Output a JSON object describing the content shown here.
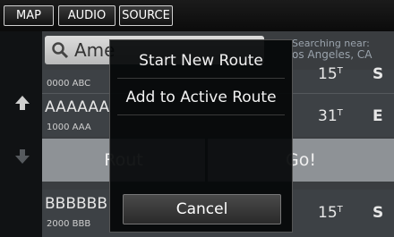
{
  "tabs": {
    "map": "MAP",
    "audio": "AUDIO",
    "source": "SOURCE"
  },
  "search": {
    "value": "Ame"
  },
  "near": {
    "label": "Searching near:",
    "location": "os Angeles, CA"
  },
  "rows": [
    {
      "title": "",
      "sub": "0000 ABC",
      "distance": "15",
      "dist_unit": "T",
      "direction": "S"
    },
    {
      "title": "AAAAAA",
      "sub": "1000 AAA",
      "distance": "31",
      "dist_unit": "T",
      "direction": "E"
    },
    {
      "title": "BBBBBB",
      "sub": "2000 BBB",
      "distance": "15",
      "dist_unit": "T",
      "direction": "S"
    }
  ],
  "buttons": {
    "route": "Rout",
    "go": "Go!"
  },
  "menu": {
    "items": [
      "Start New Route",
      "Add to Active Route"
    ],
    "cancel": "Cancel"
  }
}
